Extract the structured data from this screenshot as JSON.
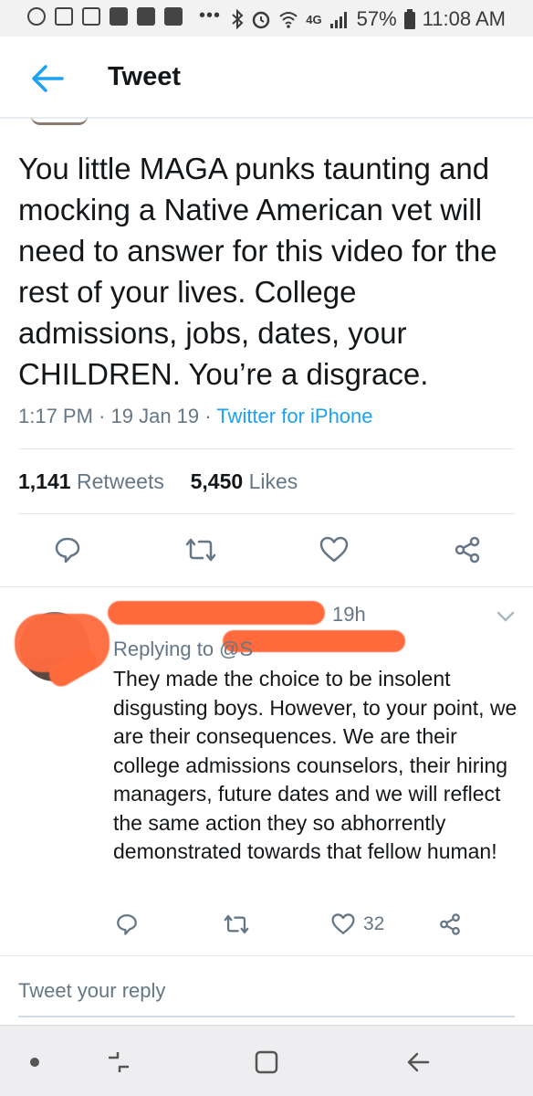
{
  "status_bar": {
    "network": "4G",
    "battery": "57%",
    "time": "11:08 AM"
  },
  "header": {
    "title": "Tweet"
  },
  "tweet": {
    "text": "You little MAGA punks taunting and mocking a Native American vet will need to answer for this video for the rest of your lives. College admissions, jobs, dates, your CHILDREN. You’re a disgrace.",
    "time": "1:17 PM",
    "date": "19 Jan 19",
    "source": "Twitter for iPhone",
    "retweets_count": "1,141",
    "retweets_label": "Retweets",
    "likes_count": "5,450",
    "likes_label": "Likes"
  },
  "reply": {
    "time_ago": "19h",
    "replying_to": "Replying to @S",
    "text": "They made the choice to be insolent disgusting boys. However, to your point, we are their consequences. We are their college admissions counselors, their hiring managers, future dates and we will reflect the same action they so abhorrently demonstrated towards that fellow human!",
    "like_count": "32"
  },
  "reply_box": {
    "placeholder": "Tweet your reply"
  },
  "colors": {
    "accent": "#1da1f2",
    "muted": "#657786",
    "redaction": "#ff6a3d"
  }
}
